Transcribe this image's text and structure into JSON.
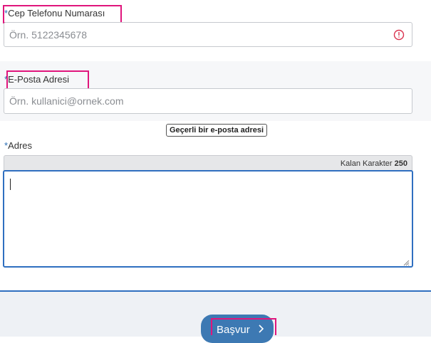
{
  "phone": {
    "label": "Cep Telefonu Numarası",
    "required_mark": "*",
    "placeholder": "Örn. 5122345678",
    "error_icon": "exclamation-circle-icon"
  },
  "email": {
    "label": "E-Posta Adresi",
    "required_mark": "*",
    "placeholder": "Örn. kullanici@ornek.com",
    "tooltip": "Geçerli bir e-posta adresi"
  },
  "address": {
    "label": "Adres",
    "required_mark": "*",
    "counter_label": "Kalan Karakter",
    "counter_value": "250"
  },
  "submit": {
    "label": "Başvur",
    "icon": "chevron-right-icon"
  },
  "colors": {
    "highlight": "#e0157c",
    "accent": "#2f6fc0",
    "error": "#d9334f"
  }
}
